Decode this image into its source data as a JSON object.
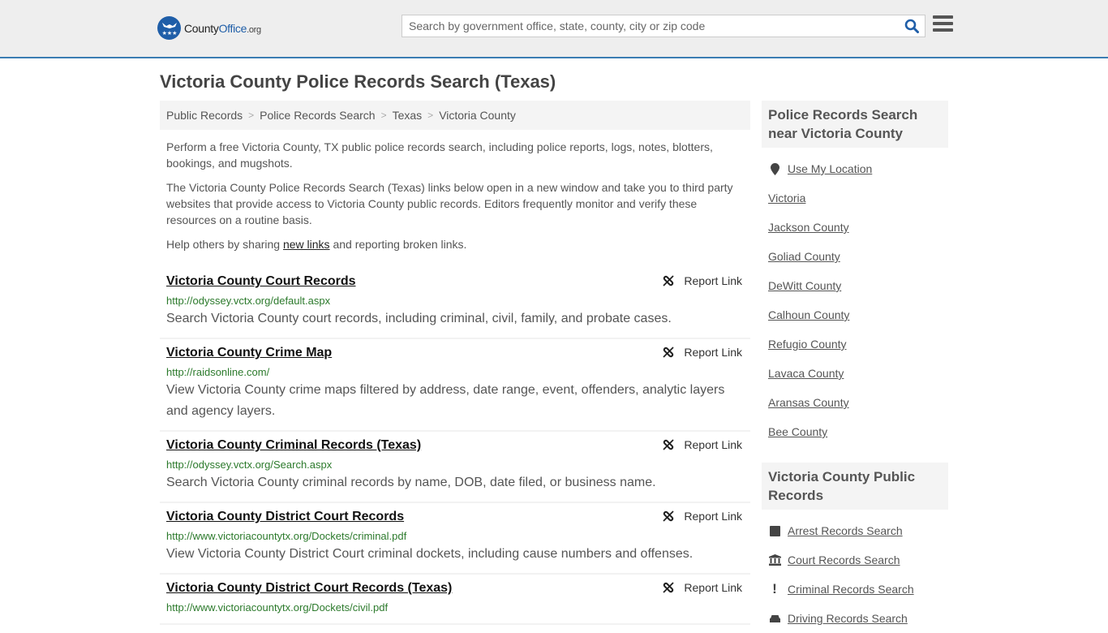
{
  "header": {
    "logo": {
      "brand_a": "County",
      "brand_b": "Office",
      "brand_c": ".org"
    },
    "search": {
      "placeholder": "Search by government office, state, county, city or zip code",
      "value": ""
    },
    "colors": {
      "brand": "#1f5ea8",
      "header_bg": "#eeeeee",
      "header_border": "#3b7db3"
    }
  },
  "page": {
    "title": "Victoria County Police Records Search (Texas)"
  },
  "breadcrumb": [
    "Public Records",
    "Police Records Search",
    "Texas",
    "Victoria County"
  ],
  "intro": {
    "p1": "Perform a free Victoria County, TX public police records search, including police reports, logs, notes, blotters, bookings, and mugshots.",
    "p2": "The Victoria County Police Records Search (Texas) links below open in a new window and take you to third party websites that provide access to Victoria County public records. Editors frequently monitor and verify these resources on a routine basis.",
    "p3_before": "Help others by sharing ",
    "p3_link": "new links",
    "p3_after": " and reporting broken links."
  },
  "listings": [
    {
      "title": "Victoria County Court Records",
      "url": "http://odyssey.vctx.org/default.aspx",
      "desc": "Search Victoria County court records, including criminal, civil, family, and probate cases.",
      "report": "Report Link"
    },
    {
      "title": "Victoria County Crime Map",
      "url": "http://raidsonline.com/",
      "desc": "View Victoria County crime maps filtered by address, date range, event, offenders, analytic layers and agency layers.",
      "report": "Report Link"
    },
    {
      "title": "Victoria County Criminal Records (Texas)",
      "url": "http://odyssey.vctx.org/Search.aspx",
      "desc": "Search Victoria County criminal records by name, DOB, date filed, or business name.",
      "report": "Report Link"
    },
    {
      "title": "Victoria County District Court Records",
      "url": "http://www.victoriacountytx.org/Dockets/criminal.pdf",
      "desc": "View Victoria County District Court criminal dockets, including cause numbers and offenses.",
      "report": "Report Link"
    },
    {
      "title": "Victoria County District Court Records (Texas)",
      "url": "http://www.victoriacountytx.org/Dockets/civil.pdf",
      "desc": "",
      "report": "Report Link"
    }
  ],
  "sidebar": {
    "nearby": {
      "heading": "Police Records Search near Victoria County",
      "use_location": "Use My Location",
      "items": [
        "Victoria",
        "Jackson County",
        "Goliad County",
        "DeWitt County",
        "Calhoun County",
        "Refugio County",
        "Lavaca County",
        "Aransas County",
        "Bee County"
      ]
    },
    "public_records": {
      "heading": "Victoria County Public Records",
      "items": [
        {
          "label": "Arrest Records Search",
          "icon": "square-icon"
        },
        {
          "label": "Court Records Search",
          "icon": "courthouse-icon"
        },
        {
          "label": "Criminal Records Search",
          "icon": "exclamation-icon"
        },
        {
          "label": "Driving Records Search",
          "icon": "car-icon"
        }
      ]
    }
  }
}
